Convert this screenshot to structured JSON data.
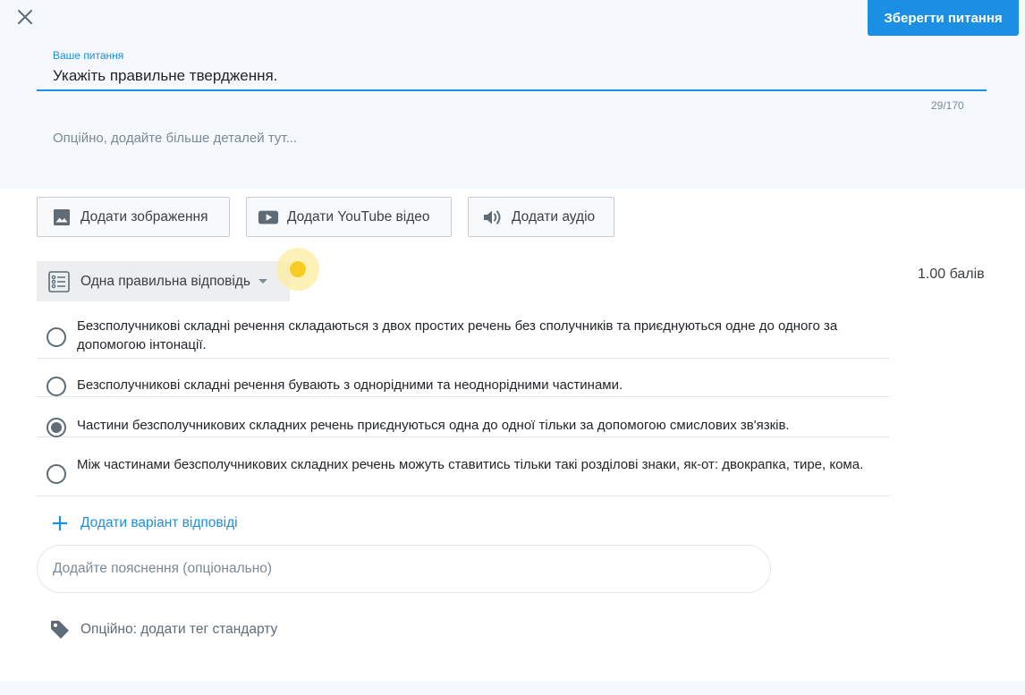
{
  "header": {
    "close_icon": "close-icon",
    "save_label": "Зберегти питання"
  },
  "question": {
    "label": "Ваше питання",
    "value": "Укажіть правильне твердження.",
    "counter": "29/170",
    "details_placeholder": "Опційно, додайте більше деталей тут..."
  },
  "media": {
    "image_label": "Додати зображення",
    "image_icon": "image-icon",
    "youtube_label": "Додати YouTube відео",
    "youtube_icon": "youtube-play-icon",
    "audio_label": "Додати аудіо",
    "audio_icon": "speaker-icon"
  },
  "question_type": {
    "label": "Одна правильна відповідь",
    "icon": "list-icon"
  },
  "points": "1.00 балів",
  "answers": [
    {
      "text": "Безсполучникові складні речення складаються з двох простих речень без  сполучників та приєднуються одне до одного за допомогою інтонації.",
      "selected": false
    },
    {
      "text": "Безсполучникові складні речення бувають з однорідними та  неоднорідними частинами.",
      "selected": false
    },
    {
      "text": "Частини безсполучникових складних речень приєднуються одна до одної  тільки за допомогою смислових зв'язків.",
      "selected": true
    },
    {
      "text": "Між частинами безсполучникових складних речень можуть ставитись  тільки такі розділові знаки, як-от: двокрапка, тире, кома.",
      "selected": false
    }
  ],
  "add_option_label": "Додати варіант відповіді",
  "explanation_placeholder": "Додайте пояснення (опціонально)",
  "tag_label": "Опційно: додати тег стандарту",
  "colors": {
    "accent": "#1a8fe3",
    "panel_bg": "#f5f8fc",
    "cursor_highlight": "#f7cd24"
  }
}
